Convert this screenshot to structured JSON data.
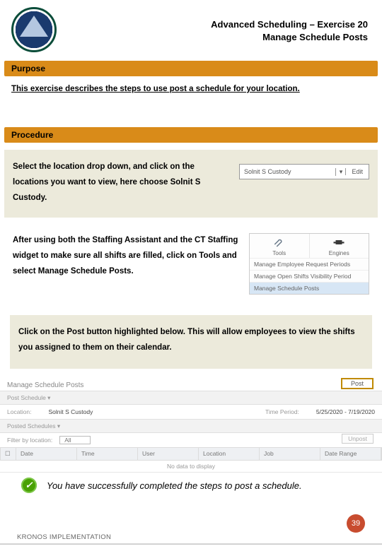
{
  "header": {
    "title_line1": "Advanced Scheduling – Exercise 20",
    "title_line2": "Manage Schedule Posts"
  },
  "sections": {
    "purpose_label": "Purpose",
    "purpose_text": "This exercise describes the steps to use post a schedule for your location.",
    "procedure_label": "Procedure"
  },
  "step1": {
    "text": "Select the location drop down, and click on the locations you want to view, here choose Solnit S Custody.",
    "dropdown_value": "Solnit S Custody",
    "edit_label": "Edit"
  },
  "step2": {
    "text": "After using both the Staffing Assistant and the CT Staffing widget to make sure all shifts are filled, click on Tools and select Manage Schedule Posts.",
    "tools_label": "Tools",
    "engines_label": "Engines",
    "menu": {
      "item1": "Manage Employee Request Periods",
      "item2": "Manage Open Shifts Visibility Period",
      "item3": "Manage Schedule Posts"
    }
  },
  "step3": {
    "text": "Click on the Post button highlighted below. This will allow employees to view the shifts you assigned to them on their calendar."
  },
  "bigshot": {
    "title": "Manage Schedule Posts",
    "post_schedule_label": "Post Schedule ▾",
    "location_label": "Location:",
    "location_value": "Solnit S Custody",
    "time_label": "Time Period:",
    "time_value": "5/25/2020 - 7/19/2020",
    "post_btn": "Post",
    "posted_label": "Posted Schedules ▾",
    "filter_label": "Filter by location:",
    "filter_value": "All",
    "unpost_btn": "Unpost",
    "columns": {
      "c1": "Date",
      "c2": "Time",
      "c3": "User",
      "c4": "Location",
      "c5": "Job",
      "c6": "Date Range"
    },
    "nodata": "No data to display"
  },
  "success": "You have successfully completed the steps to post a schedule.",
  "footer": "KRONOS IMPLEMENTATION",
  "page_number": "39"
}
